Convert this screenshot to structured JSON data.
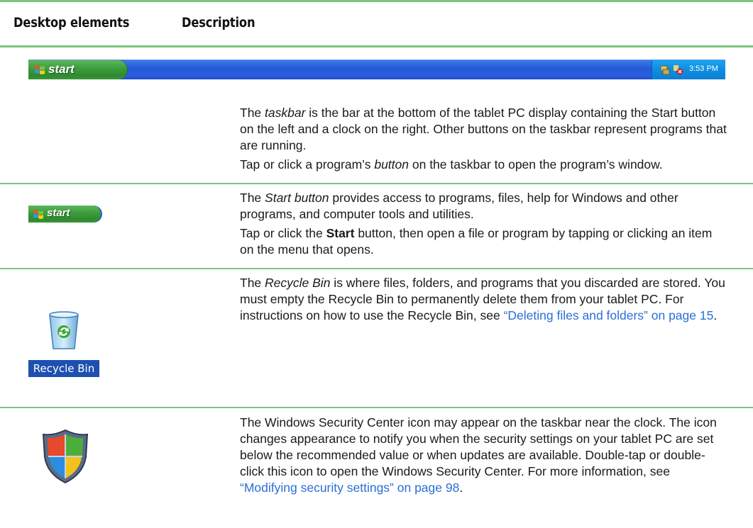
{
  "header": {
    "col1": "Desktop elements",
    "col2": "Description"
  },
  "taskbar_image": {
    "start_label": "start",
    "clock": "3:53 PM"
  },
  "rows": [
    {
      "p1_pre": "The ",
      "p1_em": "taskbar",
      "p1_post": " is the bar at the bottom of the tablet PC display containing the Start button on the left and a clock on the right. Other buttons on the taskbar represent programs that are running.",
      "p2_pre": "Tap or click a program’s ",
      "p2_em": "button",
      "p2_post": " on the taskbar to open the program’s window."
    },
    {
      "icon_label": "start",
      "p1_pre": "The ",
      "p1_em": "Start button",
      "p1_post": " provides access to programs, files, help for Windows and other programs, and computer tools and utilities.",
      "p2_pre": "Tap or click the ",
      "p2_bold": "Start",
      "p2_post": " button, then open a file or program by tapping or clicking an item on the menu that opens."
    },
    {
      "icon_label": "Recycle Bin",
      "p1_pre": "The ",
      "p1_em": "Recycle Bin",
      "p1_post": " is where files, folders, and programs that you discarded are stored. You must empty the Recycle Bin to permanently delete them from your tablet PC. For instructions on how to use the Recycle Bin, see ",
      "p1_link": "“Deleting files and folders” on page 15",
      "p1_end": "."
    },
    {
      "p1_pre": "The Windows Security Center icon may appear on the taskbar near the clock. The icon changes appearance to notify you when the security settings on your tablet PC are set below the recommended value or when updates are available. Double-tap or double-click this icon to open the Windows Security Center. For more information, see ",
      "p1_link": "“Modifying security settings” on page 98",
      "p1_end": "."
    }
  ],
  "colors": {
    "rule": "#7fc47f",
    "link": "#2a6fd6",
    "taskbar": "#2458d8",
    "start_green": "#3c9b3c"
  }
}
